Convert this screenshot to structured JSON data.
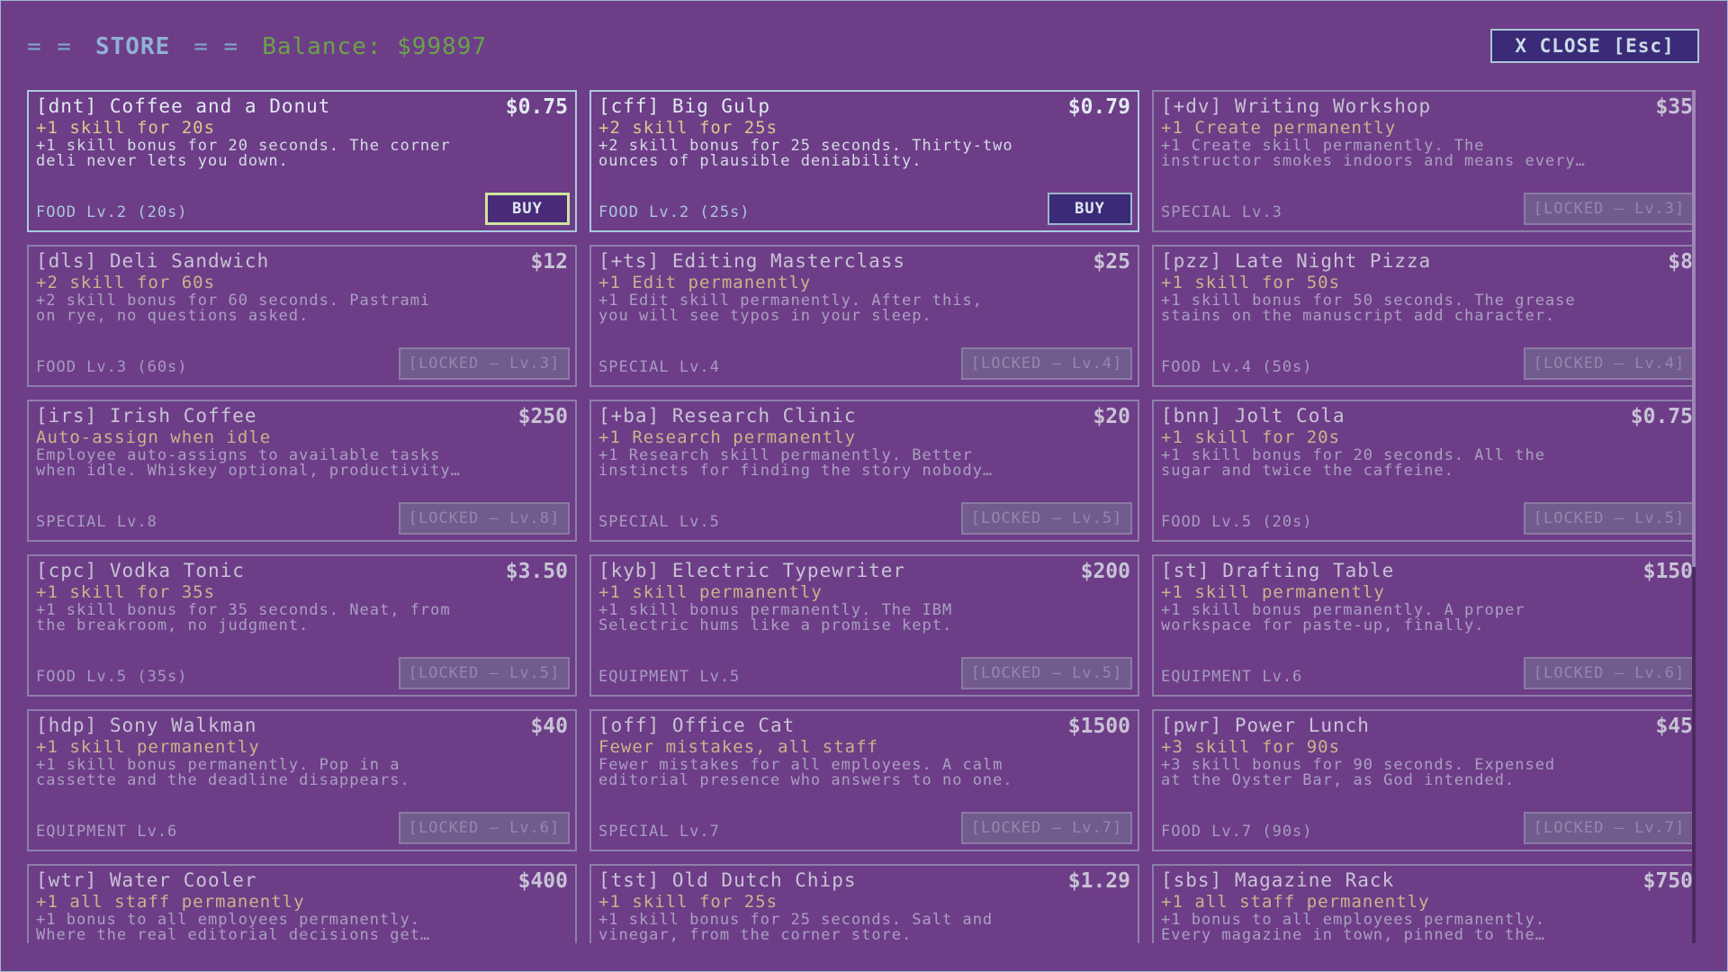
{
  "header": {
    "eq": "= =",
    "title": "STORE",
    "balance": "Balance: $99897",
    "close": "X CLOSE [Esc]"
  },
  "colors": {
    "background": "#6e3d88",
    "button": "#3b2a78",
    "balance": "#69a34a",
    "highlight": "#cfe59e"
  },
  "items": [
    {
      "name": "[dnt] Coffee and a Donut",
      "price": "$0.75",
      "effect": "+1 skill for 20s",
      "desc": "+1 skill bonus for 20 seconds. The corner\ndeli never lets you down.",
      "foot": "FOOD Lv.2 (20s)",
      "button": "BUY",
      "state": "buy",
      "highlight": true
    },
    {
      "name": "[cff] Big Gulp",
      "price": "$0.79",
      "effect": "+2 skill for 25s",
      "desc": "+2 skill bonus for 25 seconds. Thirty-two\nounces of plausible deniability.",
      "foot": "FOOD Lv.2 (25s)",
      "button": "BUY",
      "state": "buy",
      "highlight": false
    },
    {
      "name": "[+dv] Writing Workshop",
      "price": "$35",
      "effect": "+1 Create permanently",
      "desc": "+1 Create skill permanently. The\ninstructor smokes indoors and means every…",
      "foot": "SPECIAL Lv.3",
      "button": "[LOCKED — Lv.3]",
      "state": "locked"
    },
    {
      "name": "[dls] Deli Sandwich",
      "price": "$12",
      "effect": "+2 skill for 60s",
      "desc": "+2 skill bonus for 60 seconds. Pastrami\non rye, no questions asked.",
      "foot": "FOOD Lv.3 (60s)",
      "button": "[LOCKED — Lv.3]",
      "state": "locked"
    },
    {
      "name": "[+ts] Editing Masterclass",
      "price": "$25",
      "effect": "+1 Edit permanently",
      "desc": "+1 Edit skill permanently. After this,\nyou will see typos in your sleep.",
      "foot": "SPECIAL Lv.4",
      "button": "[LOCKED — Lv.4]",
      "state": "locked"
    },
    {
      "name": "[pzz] Late Night Pizza",
      "price": "$8",
      "effect": "+1 skill for 50s",
      "desc": "+1 skill bonus for 50 seconds. The grease\nstains on the manuscript add character.",
      "foot": "FOOD Lv.4 (50s)",
      "button": "[LOCKED — Lv.4]",
      "state": "locked"
    },
    {
      "name": "[irs] Irish Coffee",
      "price": "$250",
      "effect": "Auto-assign when idle",
      "desc": "Employee auto-assigns to available tasks\nwhen idle. Whiskey optional, productivity…",
      "foot": "SPECIAL Lv.8",
      "button": "[LOCKED — Lv.8]",
      "state": "locked"
    },
    {
      "name": "[+ba] Research Clinic",
      "price": "$20",
      "effect": "+1 Research permanently",
      "desc": "+1 Research skill permanently. Better\ninstincts for finding the story nobody…",
      "foot": "SPECIAL Lv.5",
      "button": "[LOCKED — Lv.5]",
      "state": "locked"
    },
    {
      "name": "[bnn] Jolt Cola",
      "price": "$0.75",
      "effect": "+1 skill for 20s",
      "desc": "+1 skill bonus for 20 seconds. All the\nsugar and twice the caffeine.",
      "foot": "FOOD Lv.5 (20s)",
      "button": "[LOCKED — Lv.5]",
      "state": "locked"
    },
    {
      "name": "[cpc] Vodka Tonic",
      "price": "$3.50",
      "effect": "+1 skill for 35s",
      "desc": "+1 skill bonus for 35 seconds. Neat, from\nthe breakroom, no judgment.",
      "foot": "FOOD Lv.5 (35s)",
      "button": "[LOCKED — Lv.5]",
      "state": "locked"
    },
    {
      "name": "[kyb] Electric Typewriter",
      "price": "$200",
      "effect": "+1 skill permanently",
      "desc": "+1 skill bonus permanently. The IBM\nSelectric hums like a promise kept.",
      "foot": "EQUIPMENT Lv.5",
      "button": "[LOCKED — Lv.5]",
      "state": "locked"
    },
    {
      "name": "[st] Drafting Table",
      "price": "$150",
      "effect": "+1 skill permanently",
      "desc": "+1 skill bonus permanently. A proper\nworkspace for paste-up, finally.",
      "foot": "EQUIPMENT Lv.6",
      "button": "[LOCKED — Lv.6]",
      "state": "locked"
    },
    {
      "name": "[hdp] Sony Walkman",
      "price": "$40",
      "effect": "+1 skill permanently",
      "desc": "+1 skill bonus permanently. Pop in a\ncassette and the deadline disappears.",
      "foot": "EQUIPMENT Lv.6",
      "button": "[LOCKED — Lv.6]",
      "state": "locked"
    },
    {
      "name": "[off] Office Cat",
      "price": "$1500",
      "effect": "Fewer mistakes, all staff",
      "desc": "Fewer mistakes for all employees. A calm\neditorial presence who answers to no one.",
      "foot": "SPECIAL Lv.7",
      "button": "[LOCKED — Lv.7]",
      "state": "locked"
    },
    {
      "name": "[pwr] Power Lunch",
      "price": "$45",
      "effect": "+3 skill for 90s",
      "desc": "+3 skill bonus for 90 seconds. Expensed\nat the Oyster Bar, as God intended.",
      "foot": "FOOD Lv.7 (90s)",
      "button": "[LOCKED — Lv.7]",
      "state": "locked"
    },
    {
      "name": "[wtr] Water Cooler",
      "price": "$400",
      "effect": "+1 all staff permanently",
      "desc": "+1 bonus to all employees permanently.\nWhere the real editorial decisions get…",
      "foot": "",
      "button": "",
      "state": "locked"
    },
    {
      "name": "[tst] Old Dutch Chips",
      "price": "$1.29",
      "effect": "+1 skill for 25s",
      "desc": "+1 skill bonus for 25 seconds. Salt and\nvinegar, from the corner store.",
      "foot": "",
      "button": "",
      "state": "locked"
    },
    {
      "name": "[sbs] Magazine Rack",
      "price": "$750",
      "effect": "+1 all staff permanently",
      "desc": "+1 bonus to all employees permanently.\nEvery magazine in town, pinned to the…",
      "foot": "",
      "button": "",
      "state": "locked"
    }
  ]
}
